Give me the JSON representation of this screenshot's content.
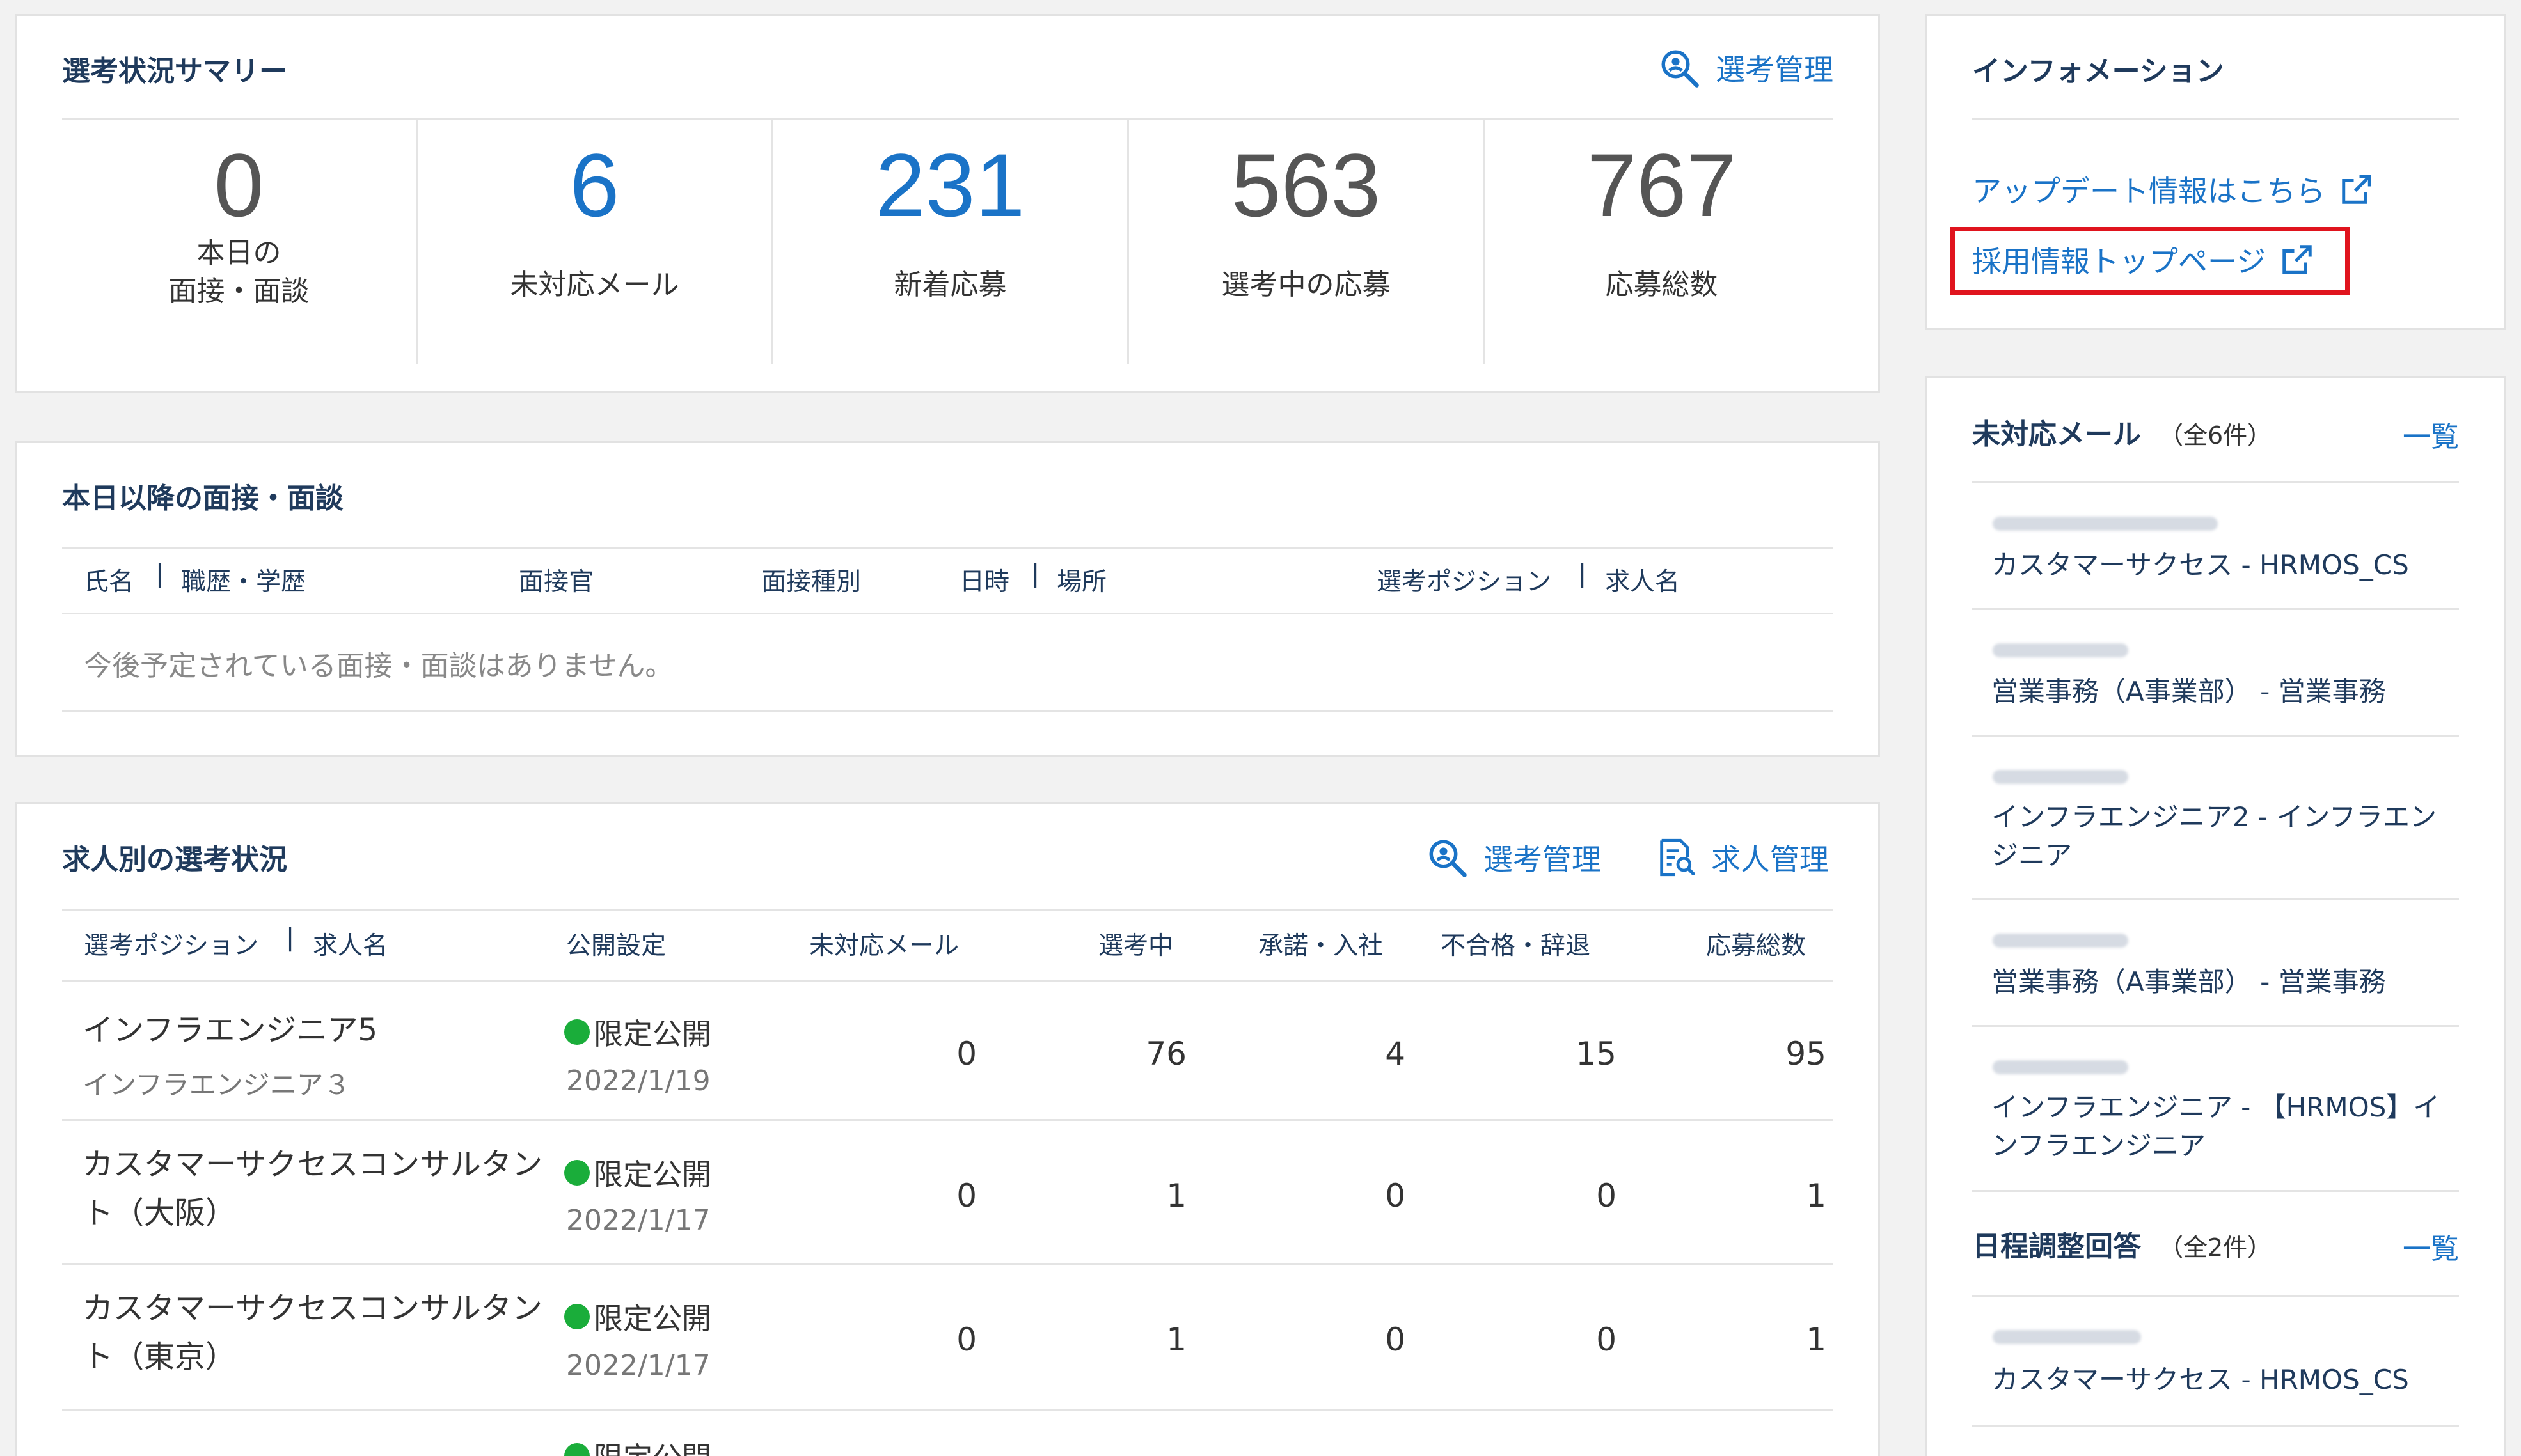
{
  "summary": {
    "title": "選考状況サマリー",
    "link_label": "選考管理",
    "stats": [
      {
        "value": "0",
        "label_line1": "本日の",
        "label_line2": "面接・面談"
      },
      {
        "value": "6",
        "label_line1": "未対応メール"
      },
      {
        "value": "231",
        "label_line1": "新着応募"
      },
      {
        "value": "563",
        "label_line1": "選考中の応募"
      },
      {
        "value": "767",
        "label_line1": "応募総数"
      }
    ]
  },
  "interviews": {
    "title": "本日以降の面接・面談",
    "columns": {
      "name": "氏名",
      "career": "職歴・学歴",
      "interviewer": "面接官",
      "type": "面接種別",
      "datetime": "日時",
      "place": "場所",
      "position": "選考ポジション",
      "job": "求人名"
    },
    "empty_message": "今後予定されている面接・面談はありません。"
  },
  "jobs": {
    "title": "求人別の選考状況",
    "link_selection": "選考管理",
    "link_jobs": "求人管理",
    "columns": {
      "position": "選考ポジション",
      "job": "求人名",
      "publish": "公開設定",
      "unread": "未対応メール",
      "in_progress": "選考中",
      "accepted": "承諾・入社",
      "rejected": "不合格・辞退",
      "total": "応募総数"
    },
    "rows": [
      {
        "name": "インフラエンジニア5",
        "sub": "インフラエンジニア３",
        "publish": "限定公開",
        "date": "2022/1/19",
        "unread": "0",
        "in_progress": "76",
        "accepted": "4",
        "rejected": "15",
        "total": "95"
      },
      {
        "name": "カスタマーサクセスコンサルタント（大阪）",
        "sub": "",
        "publish": "限定公開",
        "date": "2022/1/17",
        "unread": "0",
        "in_progress": "1",
        "accepted": "0",
        "rejected": "0",
        "total": "1"
      },
      {
        "name": "カスタマーサクセスコンサルタント（東京）",
        "sub": "",
        "publish": "限定公開",
        "date": "2022/1/17",
        "unread": "0",
        "in_progress": "1",
        "accepted": "0",
        "rejected": "0",
        "total": "1"
      },
      {
        "publish": "限定公開"
      }
    ]
  },
  "info": {
    "title": "インフォメーション",
    "update_link": "アップデート情報はこちら",
    "recruit_link": "採用情報トップページ"
  },
  "unread_mail": {
    "title": "未対応メール",
    "count": "（全6件）",
    "list_link": "一覧",
    "items": [
      {
        "text": "カスタマーサクセス - HRMOS_CS"
      },
      {
        "text": "営業事務（A事業部） - 営業事務"
      },
      {
        "text": "インフラエンジニア2 - インフラエンジニア"
      },
      {
        "text": "営業事務（A事業部） - 営業事務"
      },
      {
        "text": "インフラエンジニア - 【HRMOS】インフラエンジニア"
      }
    ]
  },
  "schedule": {
    "title": "日程調整回答",
    "count": "（全2件）",
    "list_link": "一覧",
    "items": [
      {
        "text": "カスタマーサクセス - HRMOS_CS"
      }
    ]
  },
  "colors": {
    "accent_blue": "#1a73c7",
    "title_navy": "#1f3a5c",
    "highlight_red": "#e0141e",
    "status_green": "#1aad3a"
  }
}
